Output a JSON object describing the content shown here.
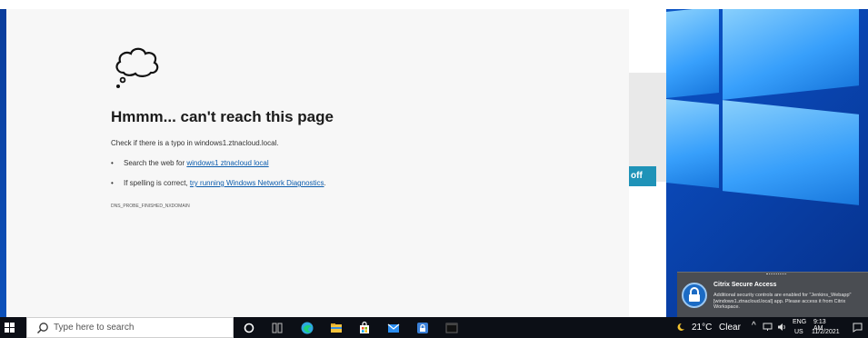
{
  "browser": {
    "error_title": "Hmmm... can't reach this page",
    "error_description": "Check if there is a typo in windows1.ztnacloud.local.",
    "suggestions": [
      {
        "prefix": "Search the web for ",
        "link": "windows1 ztnacloud local",
        "suffix": ""
      },
      {
        "prefix": "If spelling is correct, ",
        "link": "try running Windows Network Diagnostics",
        "suffix": "."
      }
    ],
    "error_code": "DNS_PROBE_FINISHED_NXDOMAIN",
    "icon": "thought-cloud-icon"
  },
  "background_window": {
    "button_label": "off",
    "button_color": "#1f93b8"
  },
  "notification": {
    "title": "Citrix Secure Access",
    "body": "Additional security controls are enabled for \"Jenkins_Webapp\"[windows1.ztnacloud.local] app. Please access it from Citrix Workspace.",
    "icon": "padlock-icon"
  },
  "taskbar": {
    "search_placeholder": "Type here to search",
    "apps": [
      "cortana-circle-icon",
      "task-view-icon",
      "edge-icon",
      "file-explorer-icon",
      "store-icon",
      "mail-icon",
      "citrix-icon",
      "terminal-icon"
    ],
    "weather_temp": "21°C",
    "weather_condition": "Clear",
    "language": "ENG",
    "language_sub": "US",
    "time": "9:13 AM",
    "date": "11/2/2021"
  },
  "colors": {
    "desktop": "#0b4fb3",
    "taskbar": "#0c0f16",
    "link": "#0b5cad"
  }
}
